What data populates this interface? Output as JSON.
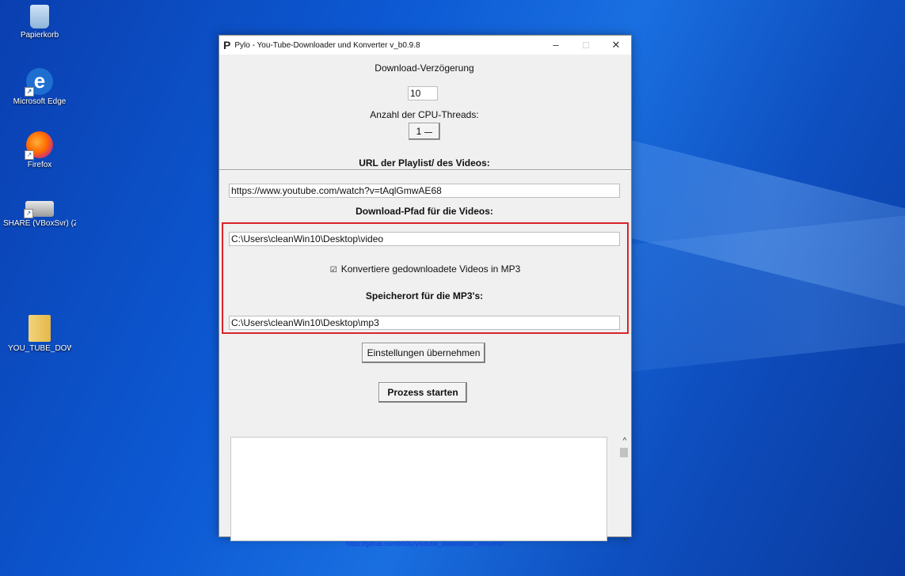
{
  "desktop": {
    "icons": [
      {
        "label": "Papierkorb"
      },
      {
        "label": "Microsoft Edge"
      },
      {
        "label": "Firefox"
      },
      {
        "label": "SHARE (VBoxSvr) (Z:)"
      },
      {
        "label": "YOU_TUBE_DOW..."
      }
    ]
  },
  "window": {
    "app_icon": "P",
    "title": "Pylo - You-Tube-Downloader und Konverter v_b0.9.8",
    "controls": {
      "minimize": "–",
      "maximize": "□",
      "close": "✕"
    },
    "download_delay_label": "Download-Verzögerung",
    "download_delay_value": "10",
    "cpu_threads_label": "Anzahl der CPU-Threads:",
    "cpu_threads_value": "1",
    "url_label": "URL der Playlist/ des Videos:",
    "url_value": "https://www.youtube.com/watch?v=tAqlGmwAE68",
    "download_path_label": "Download-Pfad für die Videos:",
    "download_path_value": "C:\\Users\\cleanWin10\\Desktop\\video",
    "convert_checkbox_label": "Konvertiere gedownloadete Videos in MP3",
    "convert_checked": true,
    "mp3_location_label": "Speicherort für die MP3's:",
    "mp3_location_value": "C:\\Users\\cleanWin10\\Desktop\\mp3",
    "apply_button": "Einstellungen übernehmen",
    "start_button": "Prozess starten",
    "log_text": "",
    "footer_link": "https://github.com/trh0ly/youtube_downloader_converter"
  },
  "colors": {
    "highlight_border": "#d8232a",
    "link": "#1a3ad8"
  }
}
